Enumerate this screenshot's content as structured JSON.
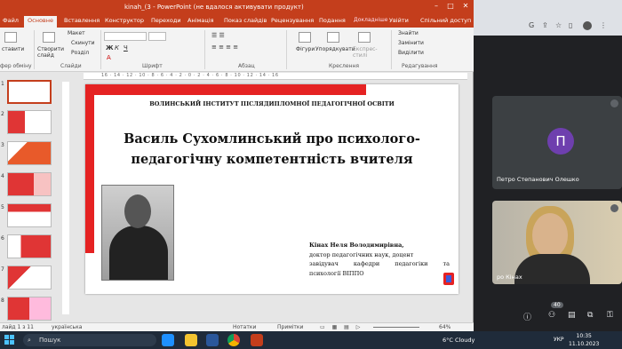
{
  "window_title": "kinah_(3 - PowerPoint (не вдалося активувати продукт)",
  "tabs": [
    "Файл",
    "Основне",
    "Вставлення",
    "Конструктор",
    "Переходи",
    "Анімація",
    "Показ слайдів",
    "Рецензування",
    "Подання"
  ],
  "tell_me": "Докладніше",
  "sign_in": "Увійти",
  "share": "Спільний доступ",
  "ribbon": {
    "paste": "ставити",
    "new_slide": "Створити слайд",
    "layout": "Макет",
    "reset": "Скинути",
    "section": "Розділ",
    "shapes": "Фігури",
    "arrange": "Упорядкувати",
    "quick_styles": "Експрес-стилі",
    "find": "Знайти",
    "replace": "Замінити",
    "select": "Виділити",
    "groups": [
      "фер обміну",
      "Слайди",
      "Шрифт",
      "Абзац",
      "Креслення",
      "Редагування"
    ]
  },
  "ruler_marks": "16 · 14 · 12 · 10 · 8 · 6 · 4 · 2 · 0 · 2 · 4 · 6 · 8 · 10 · 12 · 14 · 16",
  "thumbnail_numbers": [
    "1",
    "2",
    "3",
    "4",
    "5",
    "6",
    "7",
    "8",
    "9"
  ],
  "slide": {
    "institute": "ВОЛИНСЬКИЙ ІНСТИТУТ ПІСЛЯДИПЛОМНОЇ ПЕДАГОГІЧНОЇ ОСВІТИ",
    "title": "Василь Сухомлинський про психолого-педагогічну компетентність вчителя",
    "author_name": "Кінах Неля Володимирівна,",
    "author_line1": "доктор педагогічних наук, доцент",
    "author_line2": "завідувач кафедри педагогіки та",
    "author_line3": "психології ВІППО"
  },
  "status": {
    "slide_count": "лайд 1 з 11",
    "language": "українська",
    "notes": "Нотатки",
    "comments": "Примітки",
    "zoom": "64%"
  },
  "meet": {
    "avatar_letter": "П",
    "participant1": "Петро Степанович Олешко",
    "participant2": "ро Кінах",
    "participant_count": "40"
  },
  "taskbar": {
    "search": "Пошук",
    "weather": "6°C  Cloudy",
    "lang": "УКР",
    "time": "10:35",
    "date": "11.10.2023"
  },
  "colors": {
    "accent": "#c43e1c",
    "slide_red": "#e52222",
    "meet_avatar": "#6e3fae"
  }
}
